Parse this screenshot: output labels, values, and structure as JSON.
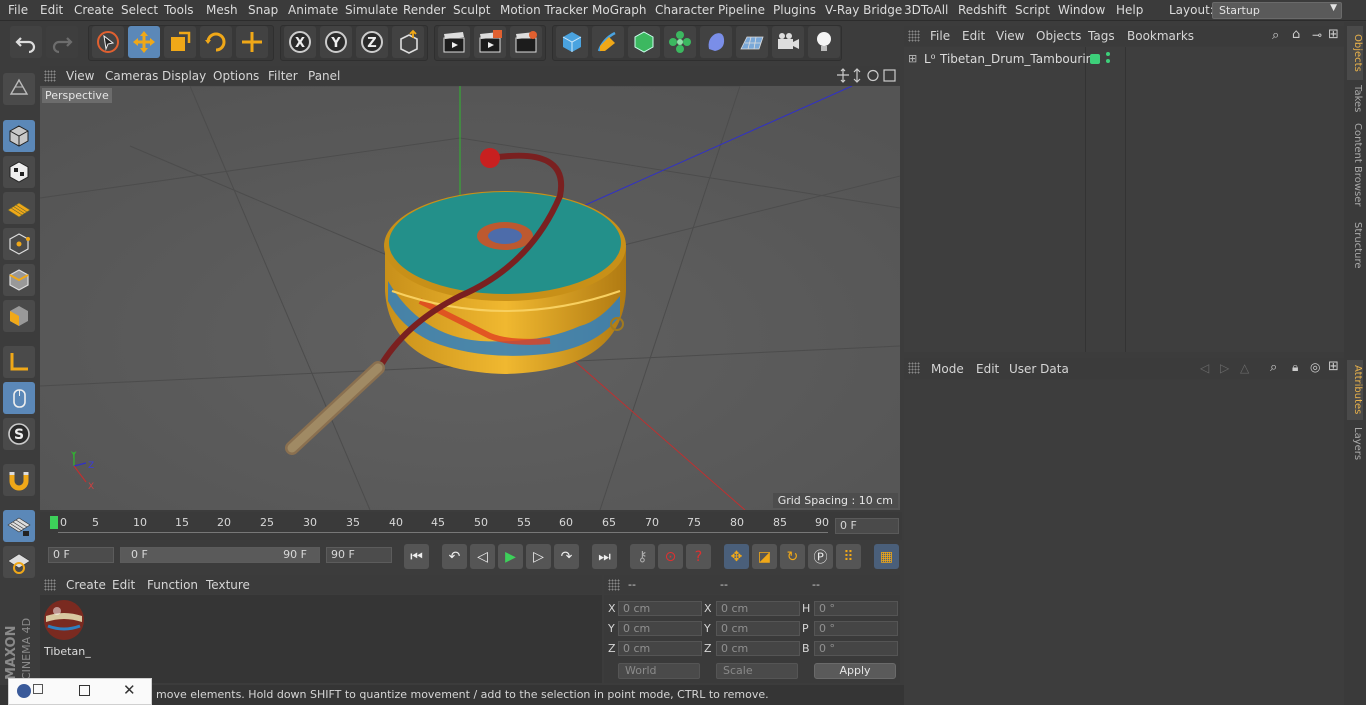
{
  "menubar": {
    "items": [
      "File",
      "Edit",
      "Create",
      "Select",
      "Tools",
      "Mesh",
      "Snap",
      "Animate",
      "Simulate",
      "Render",
      "Sculpt",
      "Motion Tracker",
      "MoGraph",
      "Character",
      "Pipeline",
      "Plugins",
      "V-Ray Bridge",
      "3DToAll",
      "Redshift",
      "Script",
      "Window",
      "Help"
    ],
    "layout_label": "Layout:",
    "layout_value": "Startup"
  },
  "viewport": {
    "menu": [
      "View",
      "Cameras",
      "Display",
      "Options",
      "Filter",
      "Panel"
    ],
    "label": "Perspective",
    "grid_spacing": "Grid Spacing : 10 cm"
  },
  "timeline": {
    "ticks": [
      "0",
      "5",
      "10",
      "15",
      "20",
      "25",
      "30",
      "35",
      "40",
      "45",
      "50",
      "55",
      "60",
      "65",
      "70",
      "75",
      "80",
      "85",
      "90"
    ],
    "current_frame": "0 F"
  },
  "playbar": {
    "start_field": "0 F",
    "range_start": "0 F",
    "range_end": "90 F",
    "end_field": "90 F"
  },
  "material_manager": {
    "menu": [
      "Create",
      "Edit",
      "Function",
      "Texture"
    ],
    "material_name": "Tibetan_"
  },
  "coordinates": {
    "header": [
      "--",
      "--",
      "--"
    ],
    "rows": [
      {
        "l1": "X",
        "v1": "0 cm",
        "l2": "X",
        "v2": "0 cm",
        "l3": "H",
        "v3": "0 °"
      },
      {
        "l1": "Y",
        "v1": "0 cm",
        "l2": "Y",
        "v2": "0 cm",
        "l3": "P",
        "v3": "0 °"
      },
      {
        "l1": "Z",
        "v1": "0 cm",
        "l2": "Z",
        "v2": "0 cm",
        "l3": "B",
        "v3": "0 °"
      }
    ],
    "mode_world": "World",
    "mode_scale": "Scale",
    "apply": "Apply"
  },
  "status": {
    "text": "move elements. Hold down SHIFT to quantize movement / add to the selection in point mode, CTRL to remove."
  },
  "object_manager": {
    "menu": [
      "File",
      "Edit",
      "View",
      "Objects",
      "Tags",
      "Bookmarks"
    ],
    "object_name": "Tibetan_Drum_Tambourine"
  },
  "attribute_manager": {
    "menu": [
      "Mode",
      "Edit",
      "User Data"
    ]
  },
  "right_tabs": [
    "Objects",
    "Takes",
    "Content Browser",
    "Structure",
    "Attributes",
    "Layers"
  ],
  "brand": {
    "line1": "MAXON",
    "line2": "CINEMA 4D"
  },
  "colors": {
    "accent": "#5b88b8",
    "active_tab": "#e8b14b",
    "drum_top": "#23908a",
    "drum_side": "#d8a020"
  }
}
